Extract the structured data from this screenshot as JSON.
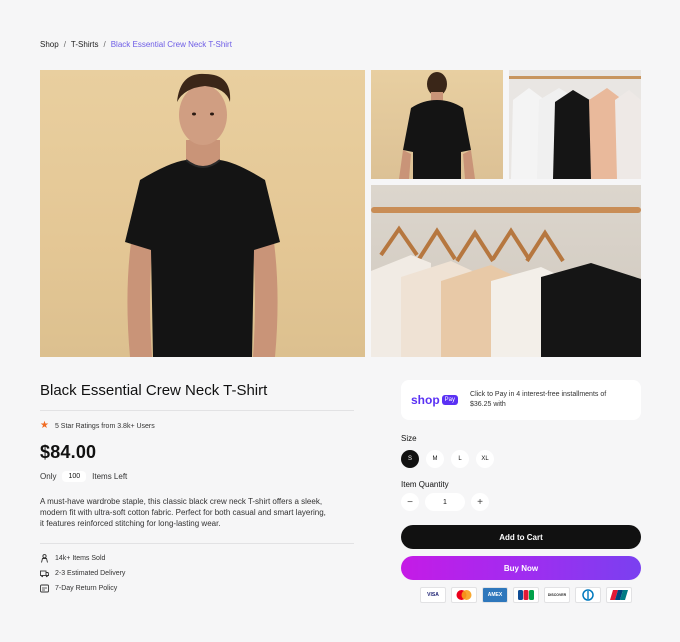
{
  "breadcrumb": {
    "items": [
      "Shop",
      "T-Shirts"
    ],
    "current": "Black Essential Crew Neck T-Shirt",
    "separator": "/"
  },
  "product": {
    "title": "Black Essential Crew Neck T-Shirt",
    "rating_text": "5 Star Ratings from 3.8k+ Users",
    "price": "$84.00",
    "stock_prefix": "Only",
    "stock_count": "100",
    "stock_suffix": "Items Left",
    "description": "A must-have wardrobe staple, this classic black crew neck T-shirt offers a sleek, modern fit with ultra-soft cotton fabric. Perfect for both casual and smart layering, it features reinforced stitching for long-lasting wear.",
    "features": [
      {
        "icon": "person-icon",
        "label": "14k+ Items Sold"
      },
      {
        "icon": "truck-icon",
        "label": "2-3 Estimated Delivery"
      },
      {
        "icon": "return-icon",
        "label": "7-Day Return Policy"
      }
    ]
  },
  "shoppay": {
    "brand": "shop",
    "badge": "Pay",
    "text": "Click to Pay in 4 interest-free installments of $36.25 with"
  },
  "size": {
    "label": "Size",
    "options": [
      "S",
      "M",
      "L",
      "XL"
    ],
    "selected": "S"
  },
  "quantity": {
    "label": "Item Quantity",
    "value": "1",
    "minus": "−",
    "plus": "+"
  },
  "buttons": {
    "add_to_cart": "Add to Cart",
    "buy_now": "Buy Now"
  },
  "payments": [
    "VISA",
    "mastercard",
    "AMEX",
    "JCB",
    "DISCOVER",
    "Diners",
    "UnionPay"
  ],
  "colors": {
    "accent": "#6d5ce6",
    "shoppay": "#5a31f4",
    "star": "#f06b22",
    "dark": "#111111",
    "buy_gradient_start": "#c51be6",
    "buy_gradient_end": "#7a40f0"
  }
}
